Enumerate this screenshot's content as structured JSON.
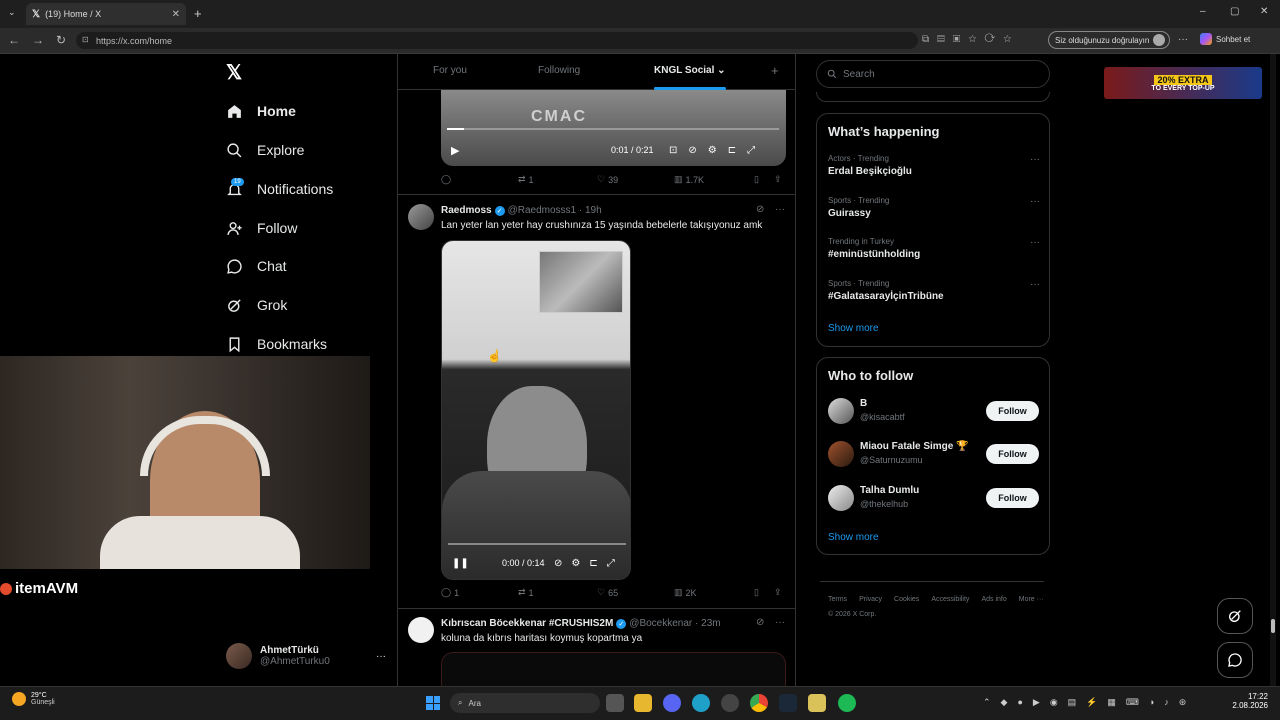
{
  "browser": {
    "tab_title": "(19) Home / X",
    "url": "https://x.com/home",
    "verify_label": "Siz olduğunuzu doğrulayın",
    "chat_label": "Sohbet et"
  },
  "nav": {
    "home": "Home",
    "explore": "Explore",
    "notifications": "Notifications",
    "notif_badge": "19",
    "follow": "Follow",
    "chat": "Chat",
    "grok": "Grok",
    "bookmarks": "Bookmarks"
  },
  "account": {
    "name": "AhmetTürkü",
    "handle": "@AhmetTurku0"
  },
  "feed_tabs": {
    "for_you": "For you",
    "following": "Following",
    "active": "KNGL Social"
  },
  "post0": {
    "time": "0:01 / 0:21",
    "replies": "",
    "reposts": "1",
    "likes": "39",
    "views": "1.7K",
    "progress": 0.05
  },
  "post1": {
    "name": "Raedmoss",
    "handle": "@Raedmosss1 · 19h",
    "text": "Lan yeter lan yeter hay crushınıza 15 yaşında bebelerle takışıyonuz amk",
    "time": "0:00 / 0:14",
    "replies": "1",
    "reposts": "1",
    "likes": "65",
    "views": "2K"
  },
  "post2": {
    "name": "Kıbrıscan Böcekkenar #CRUSHIS2M",
    "handle": "@Bocekkenar · 23m",
    "text": "koluna da kıbrıs haritası koymuş kopartma ya"
  },
  "search": {
    "placeholder": "Search"
  },
  "trends": {
    "title": "What’s happening",
    "items": [
      {
        "meta": "Actors · Trending",
        "name": "Erdal Beşikçioğlu"
      },
      {
        "meta": "Sports · Trending",
        "name": "Guirassy"
      },
      {
        "meta": "Trending in Turkey",
        "name": "#eminüstünholding"
      },
      {
        "meta": "Sports · Trending",
        "name": "#GalatasarayİçinTribüne"
      }
    ],
    "show_more": "Show more"
  },
  "who": {
    "title": "Who to follow",
    "items": [
      {
        "name": "B",
        "handle": "@kisacabtf",
        "button": "Follow"
      },
      {
        "name": "Miaou Fatale Simge 🏆",
        "handle": "@Saturnuzumu",
        "button": "Follow"
      },
      {
        "name": "Talha Dumlu",
        "handle": "@thekelhub",
        "button": "Follow"
      }
    ],
    "show_more": "Show more"
  },
  "footer": {
    "terms": "Terms",
    "privacy": "Privacy",
    "cookies": "Cookies",
    "accessibility": "Accessibility",
    "ads": "Ads info",
    "more": "More ···",
    "copy": "© 2026 X Corp."
  },
  "overlay": {
    "brand": "itemAVM"
  },
  "ad": {
    "text1": "20% EXTRA",
    "text2": "TO EVERY TOP-UP"
  },
  "taskbar": {
    "temp": "29°C",
    "weather": "Güneşli",
    "search": "Ara",
    "time": "17:22",
    "date": "2.08.2026"
  }
}
